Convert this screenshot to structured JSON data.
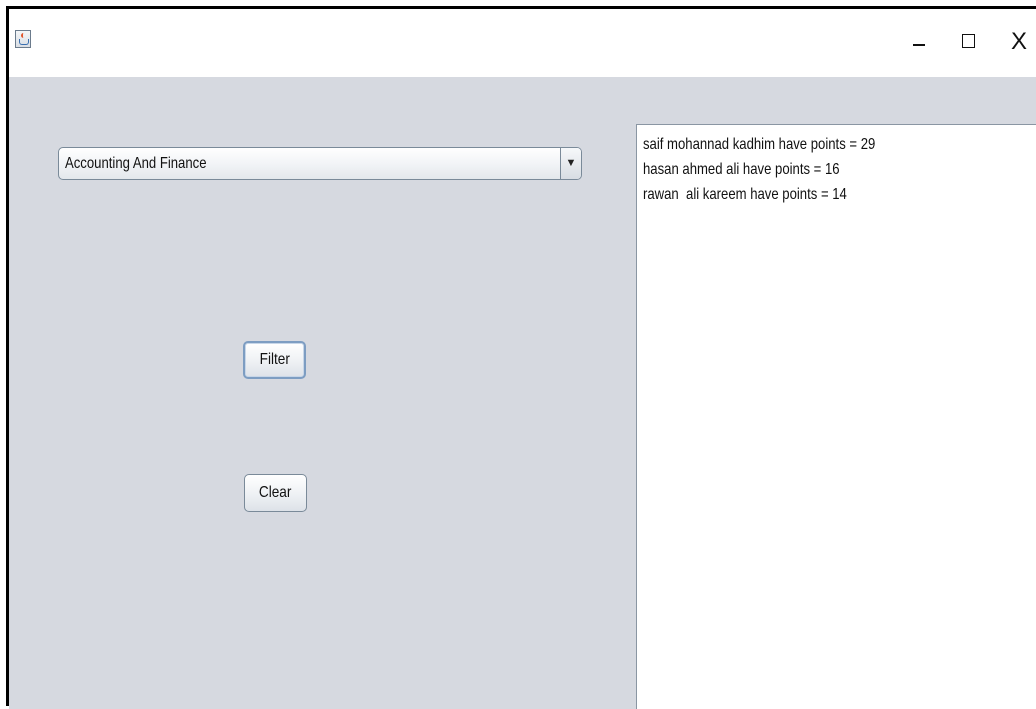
{
  "window": {
    "app_icon": "java-cup-icon",
    "minimize_icon": "minimize-icon",
    "maximize_icon": "maximize-icon",
    "close_label": "X"
  },
  "form": {
    "department_select": {
      "selected_value": "Accounting And Finance",
      "arrow_glyph": "▼"
    },
    "filter_label": "Filter",
    "clear_label": "Clear"
  },
  "results": {
    "lines": [
      "saif mohannad kadhim have points = 29",
      "hasan ahmed ali have points = 16",
      "rawan  ali kareem have points = 14"
    ]
  },
  "colors": {
    "panel_background": "#d6d9e0",
    "focus_border": "#7d9dc2"
  }
}
